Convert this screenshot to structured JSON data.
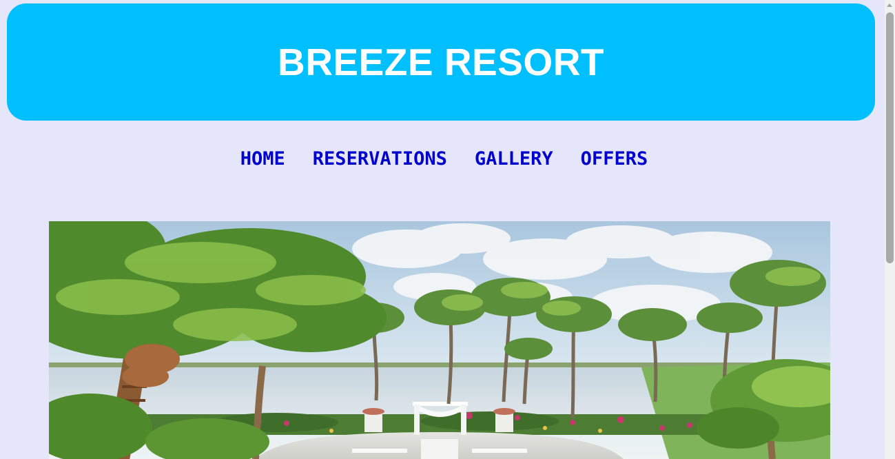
{
  "site": {
    "title": "BREEZE RESORT"
  },
  "nav": {
    "items": [
      {
        "label": "HOME"
      },
      {
        "label": "RESERVATIONS"
      },
      {
        "label": "GALLERY"
      },
      {
        "label": "OFFERS"
      }
    ]
  },
  "hero": {
    "image": "tropical-resort-wedding-venue-photo"
  },
  "colors": {
    "background": "#e6e6fa",
    "banner": "#00bfff",
    "banner_text": "#ffffff",
    "nav_link": "#0000cd"
  }
}
